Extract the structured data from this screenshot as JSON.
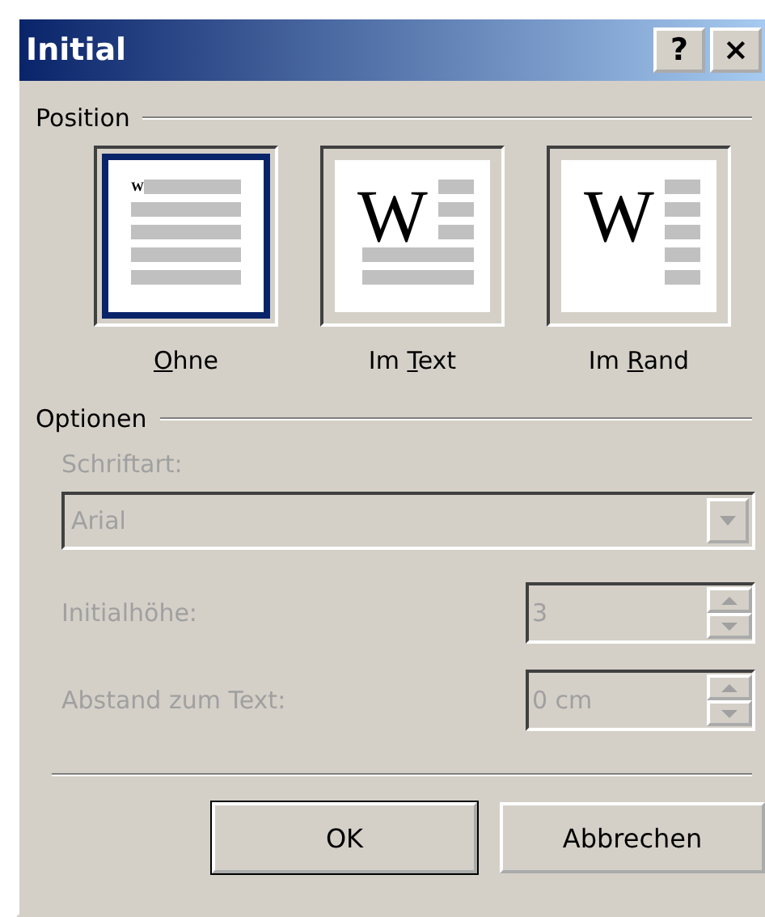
{
  "window": {
    "title": "Initial",
    "title_buttons": [
      "?",
      "×"
    ]
  },
  "position": {
    "label": "Position",
    "options": [
      {
        "kind": "none",
        "initial": "W",
        "label": "Ohne",
        "selected": true
      },
      {
        "kind": "dropped",
        "initial": "W",
        "label": "Im Text",
        "selected": false
      },
      {
        "kind": "margin",
        "initial": "W",
        "label": "Im Rand",
        "selected": false
      }
    ]
  },
  "options": {
    "label": "Optionen",
    "font_label": "Schriftart:",
    "font_value": "Arial",
    "disabled": true,
    "spinners": [
      {
        "label": "Initialhöhe:",
        "value": "3"
      },
      {
        "label": "Abstand zum Text:",
        "value": "0 cm"
      }
    ]
  },
  "buttons": [
    {
      "label": "OK",
      "default": true
    },
    {
      "label": "Abbrechen",
      "default": false
    }
  ]
}
